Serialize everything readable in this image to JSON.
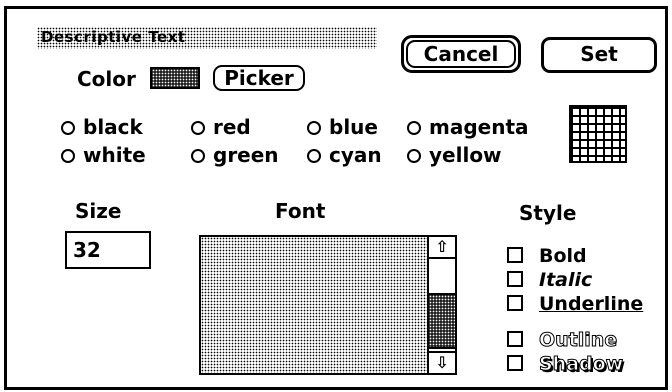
{
  "dialog": {
    "title": "Descriptive Text",
    "cancel_label": "Cancel",
    "set_label": "Set"
  },
  "color": {
    "label": "Color",
    "picker_label": "Picker",
    "swatch_color": "#333333",
    "options": [
      "black",
      "red",
      "blue",
      "magenta",
      "white",
      "green",
      "cyan",
      "yellow"
    ],
    "pattern_icon": "grid-pattern-icon"
  },
  "size": {
    "label": "Size",
    "value": "32"
  },
  "font": {
    "label": "Font",
    "scroll_up_icon": "up-arrow-icon",
    "scroll_down_icon": "down-arrow-icon"
  },
  "style": {
    "label": "Style",
    "options": [
      "Bold",
      "Italic",
      "Underline",
      "Outline",
      "Shadow"
    ]
  }
}
